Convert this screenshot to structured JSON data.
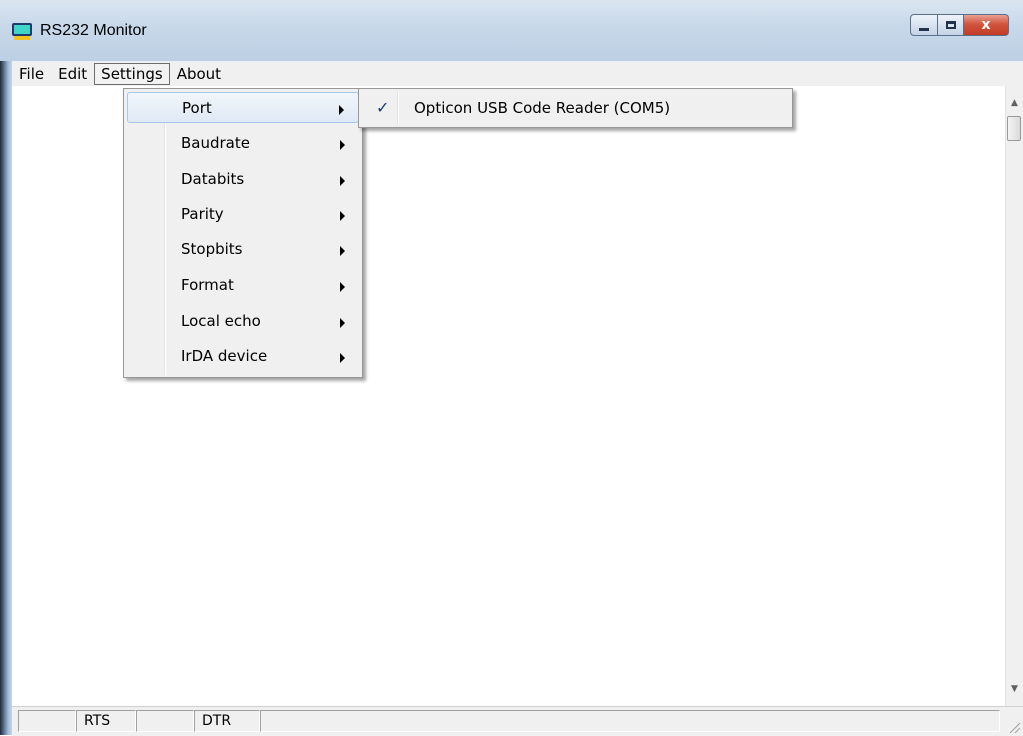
{
  "window": {
    "title": "RS232 Monitor",
    "icon": "monitor-app-icon",
    "close_glyph": "x"
  },
  "menubar": {
    "items": [
      "File",
      "Edit",
      "Settings",
      "About"
    ],
    "active": "Settings"
  },
  "settings_menu": {
    "items": [
      "Port",
      "Baudrate",
      "Databits",
      "Parity",
      "Stopbits",
      "Format",
      "Local echo",
      "IrDA device"
    ],
    "highlighted": "Port"
  },
  "port_submenu": {
    "items": [
      {
        "label": "Opticon USB Code Reader (COM5)",
        "checked": true,
        "check_glyph": "✓"
      }
    ]
  },
  "statusbar": {
    "panes": [
      "",
      "RTS",
      "",
      "DTR",
      ""
    ]
  },
  "colors": {
    "menu_highlight": "#dfe9f5",
    "checkmark": "#1a3a7a",
    "close_button": "#c23c24"
  }
}
